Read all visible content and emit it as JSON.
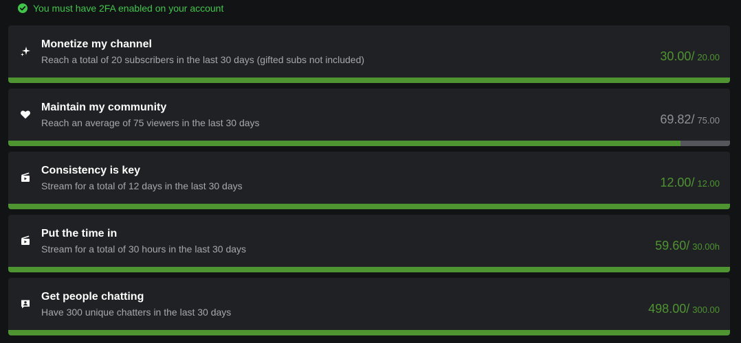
{
  "banner": {
    "text": "You must have 2FA enabled on your account",
    "icon": "check-circle-icon",
    "color": "#3fc54a"
  },
  "colors": {
    "complete": "#4e9431",
    "incomplete": "#55565b",
    "card_bg": "#202124",
    "page_bg": "#121315"
  },
  "goals": [
    {
      "icon": "sparkles-icon",
      "title": "Monetize my channel",
      "description": "Reach a total of 20 subscribers in the last 30 days (gifted subs not included)",
      "current": "30.00",
      "separator": "/",
      "target": "20.00",
      "progress": 1.0,
      "complete": true
    },
    {
      "icon": "heart-icon",
      "title": "Maintain my community",
      "description": "Reach an average of 75 viewers in the last 30 days",
      "current": "69.82",
      "separator": "/",
      "target": "75.00",
      "progress": 0.931,
      "complete": false
    },
    {
      "icon": "broadcast-icon",
      "title": "Consistency is key",
      "description": "Stream for a total of 12 days in the last 30 days",
      "current": "12.00",
      "separator": "/",
      "target": "12.00",
      "progress": 1.0,
      "complete": true
    },
    {
      "icon": "broadcast-icon",
      "title": "Put the time in",
      "description": "Stream for a total of 30 hours in the last 30 days",
      "current": "59.60",
      "separator": "/",
      "target": "30.00h",
      "progress": 1.0,
      "complete": true
    },
    {
      "icon": "chat-user-icon",
      "title": "Get people chatting",
      "description": "Have 300 unique chatters in the last 30 days",
      "current": "498.00",
      "separator": "/",
      "target": "300.00",
      "progress": 1.0,
      "complete": true
    }
  ]
}
